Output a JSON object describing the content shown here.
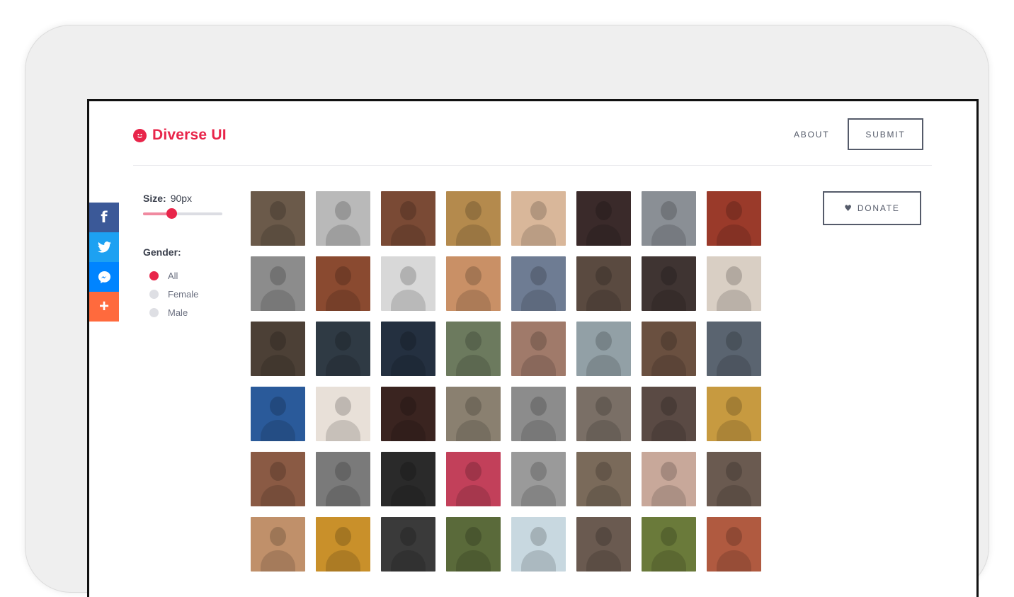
{
  "brand": {
    "name": "Diverse UI",
    "logo_icon": "smile-face-icon",
    "color": "#e8254a"
  },
  "nav": {
    "about": "ABOUT",
    "submit": "SUBMIT"
  },
  "share": [
    "facebook-icon",
    "twitter-icon",
    "messenger-icon",
    "plus-icon"
  ],
  "share_plus_glyph": "+",
  "share_fb_glyph": "f",
  "filters": {
    "size_label": "Size:",
    "size_value": "90px",
    "size_slider_fraction": 0.36,
    "gender_label": "Gender:",
    "gender_options": [
      {
        "label": "All",
        "selected": true
      },
      {
        "label": "Female",
        "selected": false
      },
      {
        "label": "Male",
        "selected": false
      }
    ]
  },
  "donate": {
    "label": "DONATE",
    "icon": "heart-icon"
  },
  "avatars": [
    "#6b5a4a",
    "#b9b9b9",
    "#7a4a35",
    "#b48a4d",
    "#d9b79a",
    "#3a2a2a",
    "#8a8f95",
    "#9a3a2a",
    "#8c8c8c",
    "#8a4a30",
    "#d8d8d8",
    "#c99066",
    "#6e7c93",
    "#5a4a40",
    "#3f3432",
    "#d9cfc4",
    "#4c4036",
    "#2f3a44",
    "#243040",
    "#6c7a5e",
    "#a07a6a",
    "#92a0a6",
    "#6a5040",
    "#5a6470",
    "#2a5a9a",
    "#e8e0d8",
    "#3a2420",
    "#8a8070",
    "#8c8c8c",
    "#7a6f66",
    "#5a4a44",
    "#c79a40",
    "#8a5a44",
    "#7a7a7a",
    "#2a2a2a",
    "#c2405a",
    "#9a9a9a",
    "#7a6a5a",
    "#c8a89a",
    "#6a5a50",
    "#c0906a",
    "#c9902a",
    "#3a3a3a",
    "#5a6a3a",
    "#c8d8e0",
    "#6a5a50",
    "#6a7a3a",
    "#b05a40"
  ]
}
